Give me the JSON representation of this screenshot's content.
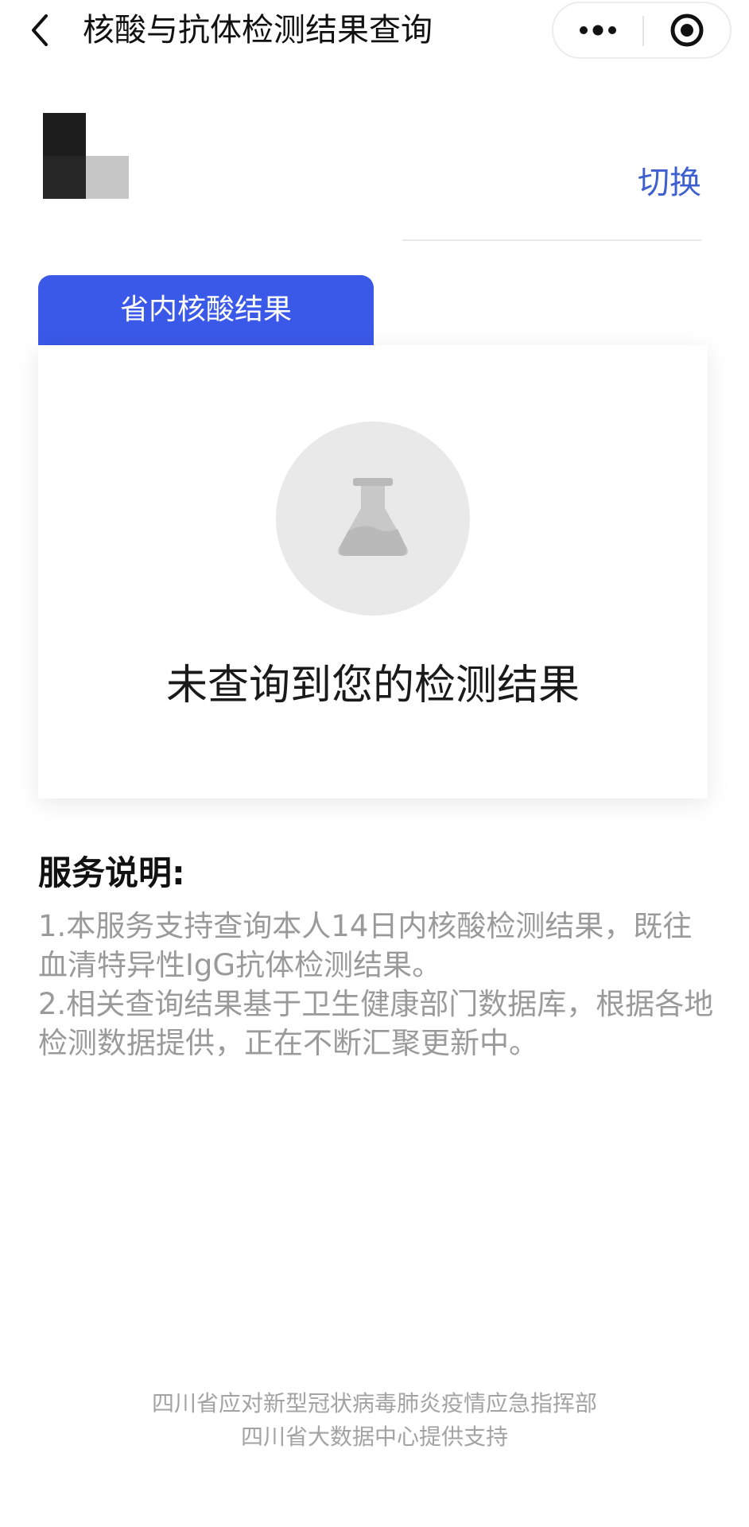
{
  "navbar": {
    "title": "核酸与抗体检测结果查询",
    "back_icon": "chevron-left-icon",
    "more_icon": "more-dots-icon",
    "close_icon": "target-circle-icon"
  },
  "user": {
    "switch_label": "切换"
  },
  "tab": {
    "label": "省内核酸结果",
    "color": "#3a59e8"
  },
  "result_card": {
    "icon": "flask-icon",
    "empty_message": "未查询到您的检测结果"
  },
  "service": {
    "title": "服务说明:",
    "items": [
      "1.本服务支持查询本人14日内核酸检测结果，既往血清特异性IgG抗体检测结果。",
      "2.相关查询结果基于卫生健康部门数据库，根据各地检测数据提供，正在不断汇聚更新中。"
    ]
  },
  "footer": {
    "line1": "四川省应对新型冠状病毒肺炎疫情应急指挥部",
    "line2": "四川省大数据中心提供支持"
  },
  "colors": {
    "accent_blue": "#3a59e8",
    "link_blue": "#3d5fcf",
    "muted_text": "#9a9a9a"
  }
}
